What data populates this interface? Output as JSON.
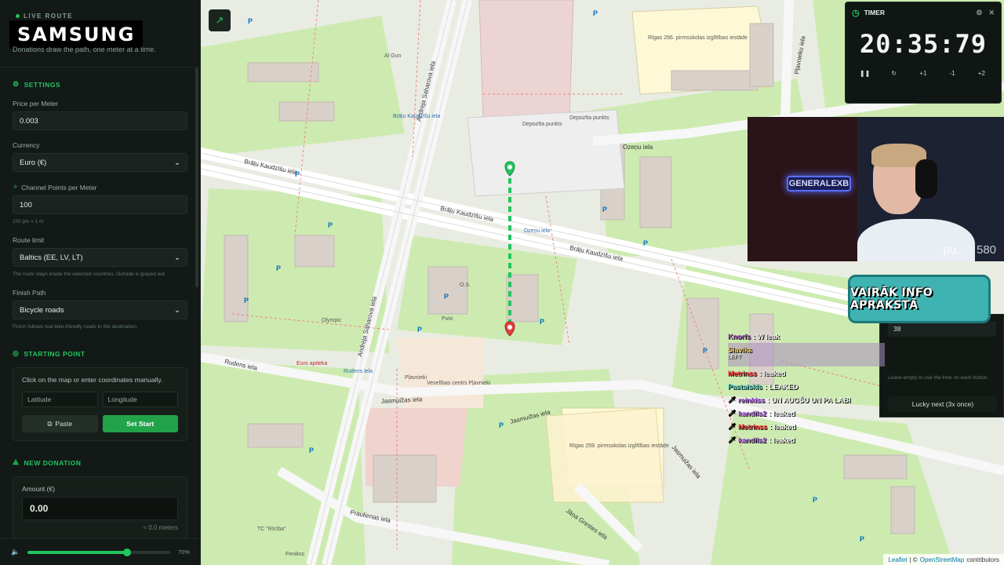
{
  "sidebar": {
    "live_route": "LIVE ROUTE",
    "brand": "SAMSUNG",
    "tagline": "Donations draw the path, one meter at a time.",
    "settings_title": "SETTINGS",
    "price_label": "Price per Meter",
    "price_value": "0.003",
    "currency_label": "Currency",
    "currency_value": "Euro (€)",
    "channel_points_label": "Channel Points per Meter",
    "channel_points_value": "100",
    "channel_points_hint": "100 pts = 1 m",
    "route_limit_label": "Route limit",
    "route_limit_value": "Baltics (EE, LV, LT)",
    "route_limit_hint": "The route stays inside the selected countries. Outside is grayed out.",
    "finish_path_label": "Finish Path",
    "finish_path_value": "Bicycle roads",
    "finish_path_hint": "Finish follows real bike-friendly roads to the destination.",
    "starting_point_title": "STARTING POINT",
    "starting_point_text": "Click on the map or enter coordinates manually.",
    "latitude_placeholder": "Latitude",
    "longitude_placeholder": "Longitude",
    "paste_label": "Paste",
    "set_start_label": "Set Start",
    "new_donation_title": "NEW DONATION",
    "amount_label": "Amount (€)",
    "amount_value": "0.00",
    "meters_text": "≈ 0.0 meters",
    "volume_pct": "70%",
    "volume_level": 0.7
  },
  "timer": {
    "title": "TIMER",
    "display": "20:35:79",
    "controls": [
      "+1",
      "-1",
      "+2"
    ]
  },
  "map": {
    "streets": {
      "brlu_kaudzisu_1": "Brāļu Kaudzīšu iela",
      "brlu_kaudzisu_2": "Brāļu Kaudzīšu iela",
      "brlu_kaudzisu_3": "Brāļu Kaudzīšu iela",
      "andreja_saharova_1": "Andreja Saharova iela",
      "andreja_saharova_2": "Andreja Saharova iela",
      "ozenu": "Ozeņu iela",
      "rudens": "Rudens iela",
      "jasmuizas_1": "Jasmuižas iela",
      "jasmuizas_2": "Jasmuižas iela",
      "jasmuizas_3": "Jasmuižas iela",
      "praulienas": "Praulienas iela",
      "jana_grestes": "Jāņa Grestes iela",
      "plavnieku": "Pļavnieku iela"
    },
    "labels": {
      "school_266": "Rīgas 266. pirmsskolas izglītības iestāde",
      "school_259": "Rīgas 259. pirmsskolas izglītības iestāde",
      "depozita_1": "Depozīta punkts",
      "depozita_2": "Depozīta punkts",
      "al_gun": "Al Gun",
      "olympic": "Olympic",
      "euro_aptieka": "Euro aptieka",
      "plavnieki": "Pļavnieki",
      "veselibas": "Veselības centrs Pļavnieki",
      "rudens_iela_bus": "Rudens iela",
      "dzenu_iela_bus": "Dzeņu iela",
      "bralu_kaudzisu_bus": "Brāļu Kaudzīšu iela",
      "puto": "Puto",
      "os": "O.S.",
      "tc_riciba": "TC \"Rīcība\"",
      "feniks": "Fenikss"
    },
    "attribution_leaflet": "Leaflet",
    "attribution_sep": "| ©",
    "attribution_osm": "OpenStreetMap",
    "attribution_contrib": "contributors"
  },
  "stream": {
    "cam_text": "pu... - 580",
    "neon": "GENERALEXB",
    "banner": "VAIRĀK INFO APRAKSTĀ",
    "right_panel_value": "38",
    "right_panel_hint": "Leave empty to use the time on each button.",
    "lucky_button": "Lucky next (3x once)"
  },
  "chat": [
    {
      "user": "Knorfs",
      "color": "#9b59b6",
      "msg": ": W leak"
    },
    {
      "user": "Slaviks",
      "color": "#e8c14a",
      "msg": "",
      "sub": "LEFT"
    },
    {
      "user": "Metrinss",
      "color": "#ff3b3b",
      "msg": ": leaked"
    },
    {
      "user": "Pastaiskls",
      "color": "#3bd1d1",
      "msg": ": LEAKED"
    },
    {
      "user": "reinkiss",
      "color": "#c267ff",
      "msg": ": UN AUGŠU UN PA LABI"
    },
    {
      "user": "kandils2",
      "color": "#c267ff",
      "msg": ": leaked"
    },
    {
      "user": "Metrinss",
      "color": "#ff3b3b",
      "msg": ": leaked"
    },
    {
      "user": "kandils2",
      "color": "#c267ff",
      "msg": ": leaked"
    }
  ],
  "colors": {
    "accent": "#22c55e",
    "route_start": "#22c55e",
    "route_end": "#e04040"
  },
  "icons": [
    "gear-icon",
    "pin-icon",
    "sparkle-icon",
    "clipboard-icon",
    "arrow-up-icon",
    "speaker-icon",
    "trend-icon",
    "clock-icon",
    "close-icon",
    "pause-icon",
    "reset-icon"
  ]
}
